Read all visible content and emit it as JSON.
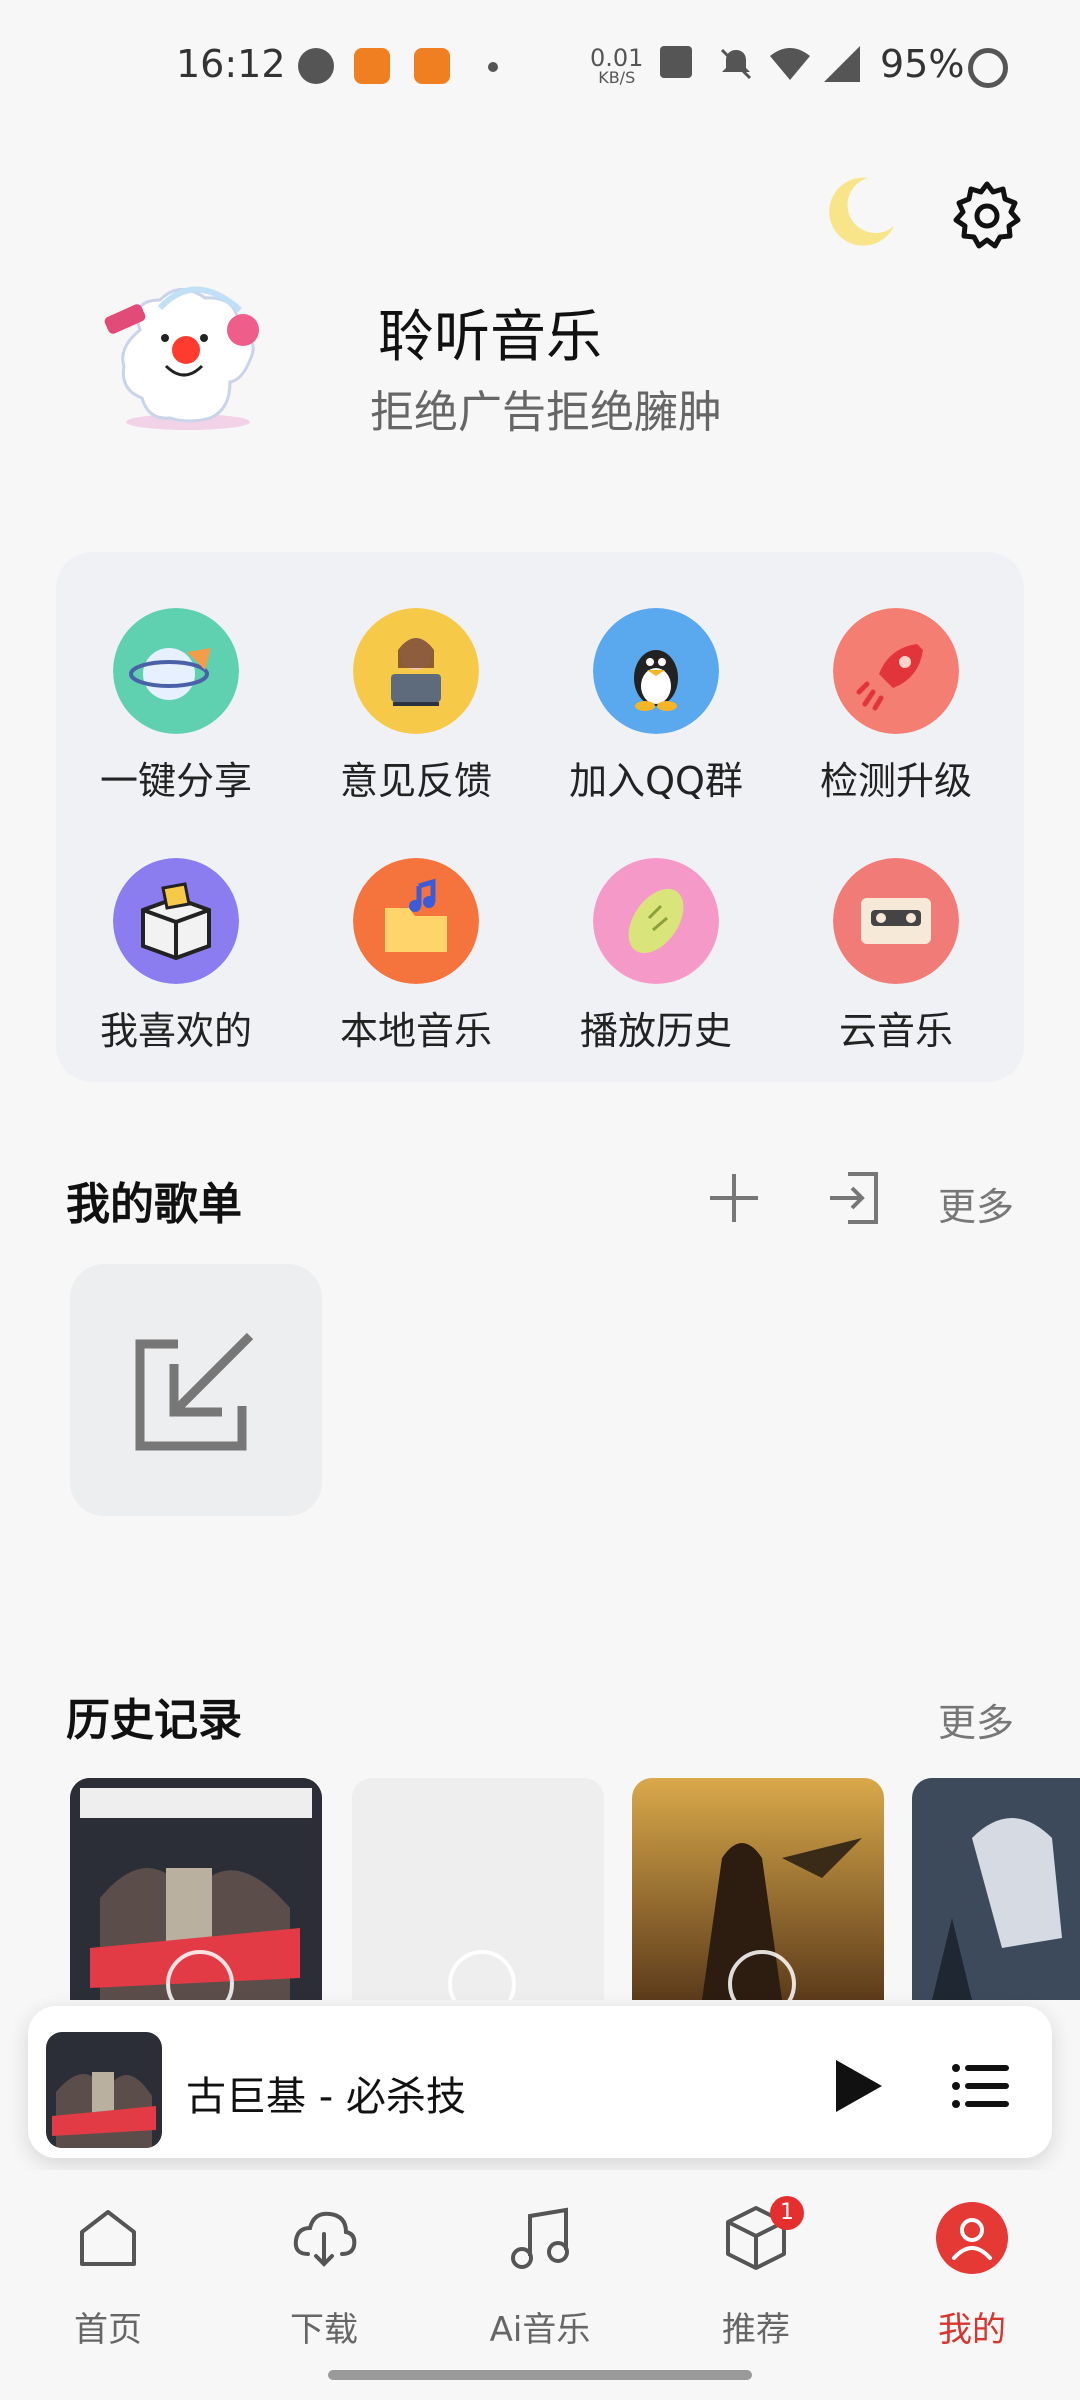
{
  "status_bar": {
    "time": "16:12",
    "net_speed_value": "0.01",
    "net_speed_unit": "KB/S",
    "battery": "95%"
  },
  "header": {
    "title": "聆听音乐",
    "subtitle": "拒绝广告拒绝臃肿"
  },
  "grid": {
    "items": [
      {
        "label": "一键分享",
        "icon": "share-icon",
        "color": "#5fd1b0"
      },
      {
        "label": "意见反馈",
        "icon": "feedback-icon",
        "color": "#f7c948"
      },
      {
        "label": "加入QQ群",
        "icon": "qq-icon",
        "color": "#5aa8ee"
      },
      {
        "label": "检测升级",
        "icon": "rocket-icon",
        "color": "#f47e72"
      },
      {
        "label": "我喜欢的",
        "icon": "favorites-box-icon",
        "color": "#8b7cf0"
      },
      {
        "label": "本地音乐",
        "icon": "folder-music-icon",
        "color": "#f5733c"
      },
      {
        "label": "播放历史",
        "icon": "history-icon",
        "color": "#f59ac8"
      },
      {
        "label": "云音乐",
        "icon": "cassette-icon",
        "color": "#f17b76"
      }
    ]
  },
  "playlists": {
    "title": "我的歌单",
    "more": "更多"
  },
  "history": {
    "title": "历史记录",
    "more": "更多"
  },
  "player": {
    "title": "古巨基 - 必杀技"
  },
  "tabs": [
    {
      "label": "首页",
      "icon": "home-icon"
    },
    {
      "label": "下载",
      "icon": "cloud-download-icon"
    },
    {
      "label": "Ai音乐",
      "icon": "music-note-icon"
    },
    {
      "label": "推荐",
      "icon": "cube-icon",
      "badge": "1"
    },
    {
      "label": "我的",
      "icon": "profile-icon",
      "active": true
    }
  ],
  "colors": {
    "accent": "#d9352f",
    "card_bg": "#eff1f5"
  }
}
